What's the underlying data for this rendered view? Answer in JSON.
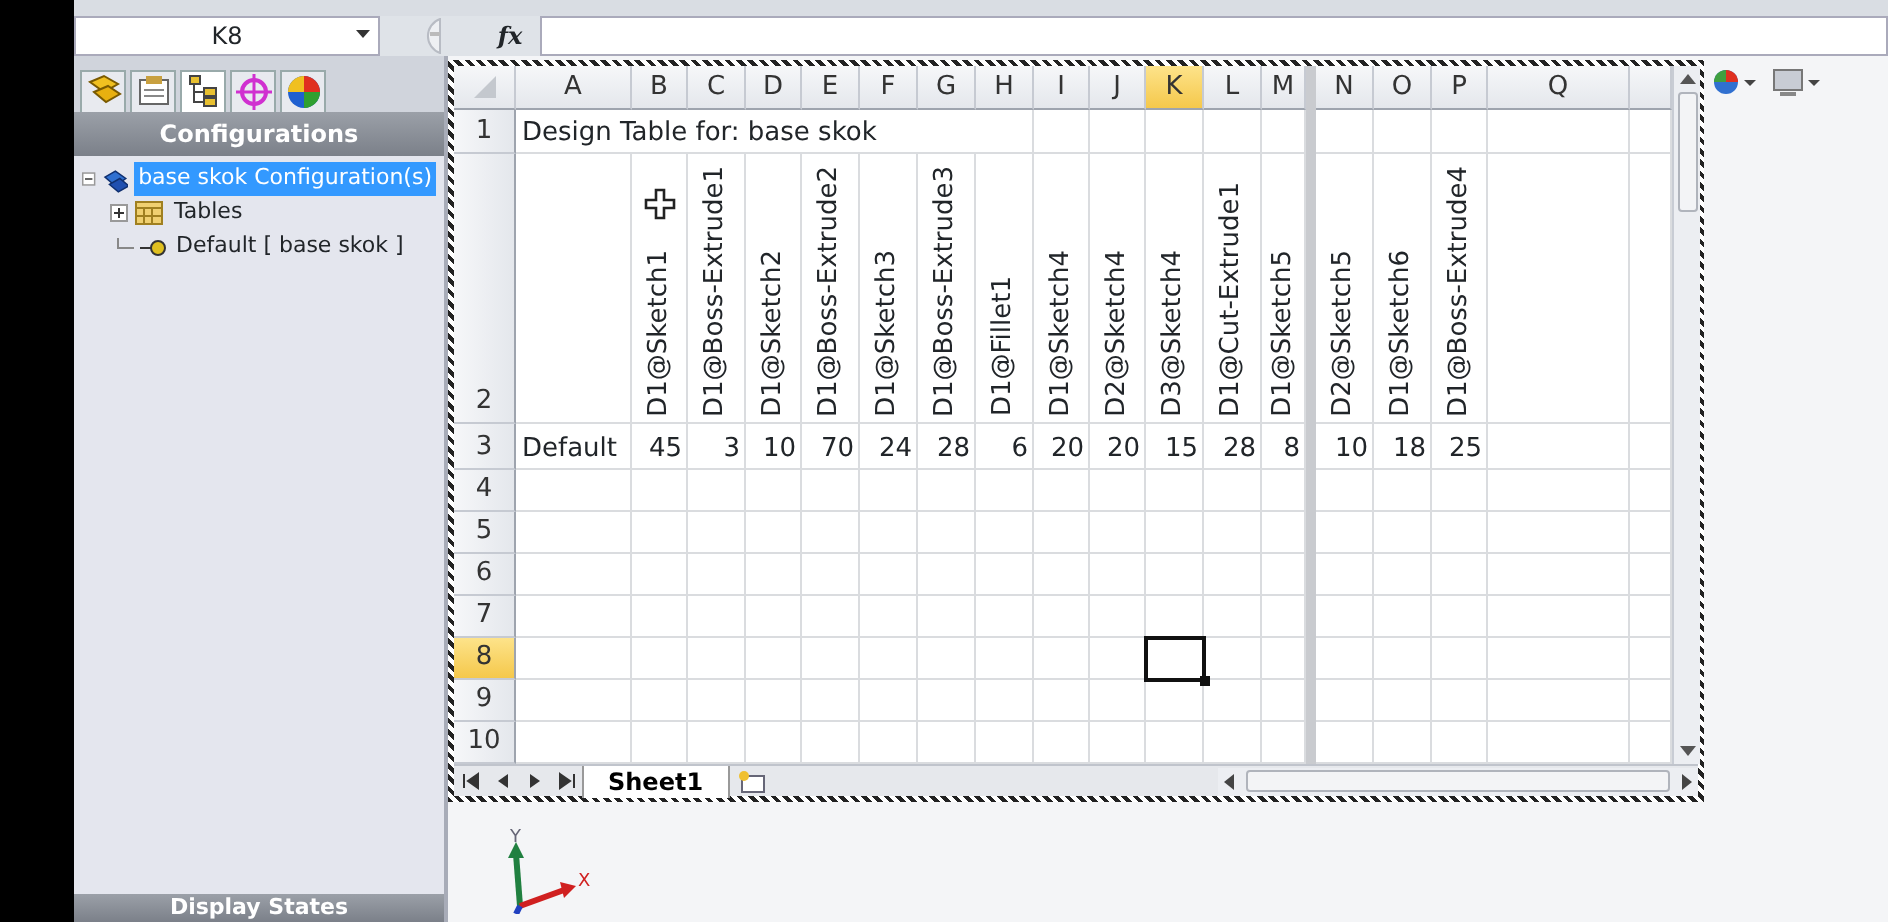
{
  "formula_bar": {
    "name_box": "K8",
    "function_label": "fx"
  },
  "config_panel": {
    "tabs": [
      {
        "selected": false
      },
      {
        "selected": false
      },
      {
        "selected": true
      },
      {
        "selected": false
      },
      {
        "selected": false
      }
    ],
    "title": "Configurations",
    "tree": [
      {
        "label": "base skok Configuration(s)",
        "selected": true,
        "expanded": true,
        "children": [
          {
            "label": "Tables",
            "selected": false,
            "expanded": false
          },
          {
            "label": "Default [ base skok ]",
            "selected": false
          }
        ]
      }
    ],
    "footer_title": "Display States"
  },
  "sheet": {
    "columns": [
      {
        "label": "A",
        "selected": false,
        "split_after": false
      },
      {
        "label": "B",
        "selected": false,
        "split_after": false
      },
      {
        "label": "C",
        "selected": false,
        "split_after": false
      },
      {
        "label": "D",
        "selected": false,
        "split_after": false
      },
      {
        "label": "E",
        "selected": false,
        "split_after": false
      },
      {
        "label": "F",
        "selected": false,
        "split_after": false
      },
      {
        "label": "G",
        "selected": false,
        "split_after": false
      },
      {
        "label": "H",
        "selected": false,
        "split_after": false
      },
      {
        "label": "I",
        "selected": false,
        "split_after": false
      },
      {
        "label": "J",
        "selected": false,
        "split_after": false
      },
      {
        "label": "K",
        "selected": true,
        "split_after": false
      },
      {
        "label": "L",
        "selected": false,
        "split_after": false
      },
      {
        "label": "M",
        "selected": false,
        "split_after": true
      },
      {
        "label": "N",
        "selected": false,
        "split_after": false
      },
      {
        "label": "O",
        "selected": false,
        "split_after": false
      },
      {
        "label": "P",
        "selected": false,
        "split_after": false
      },
      {
        "label": "Q",
        "selected": false,
        "split_after": false
      }
    ],
    "rows": [
      {
        "label": "1",
        "selected": false,
        "kind": "title",
        "text": "Design Table for: base skok"
      },
      {
        "label": "2",
        "selected": false,
        "kind": "headers",
        "cells": [
          "D1@Sketch1",
          "D1@Boss-Extrude1",
          "D1@Sketch2",
          "D1@Boss-Extrude2",
          "D1@Sketch3",
          "D1@Boss-Extrude3",
          "D1@Fillet1",
          "D1@Sketch4",
          "D2@Sketch4",
          "D3@Sketch4",
          "D1@Cut-Extrude1",
          "D1@Sketch5",
          "D2@Sketch5",
          "D1@Sketch6",
          "D1@Boss-Extrude4"
        ]
      },
      {
        "label": "3",
        "selected": false,
        "kind": "values",
        "name": "Default",
        "cells": [
          "45",
          "3",
          "10",
          "70",
          "24",
          "28",
          "6",
          "20",
          "20",
          "15",
          "28",
          "8",
          "10",
          "18",
          "25"
        ]
      },
      {
        "label": "4",
        "selected": false,
        "kind": "empty"
      },
      {
        "label": "5",
        "selected": false,
        "kind": "empty"
      },
      {
        "label": "6",
        "selected": false,
        "kind": "empty"
      },
      {
        "label": "7",
        "selected": false,
        "kind": "empty"
      },
      {
        "label": "8",
        "selected": true,
        "kind": "empty"
      },
      {
        "label": "9",
        "selected": false,
        "kind": "empty"
      },
      {
        "label": "10",
        "selected": false,
        "kind": "empty"
      }
    ],
    "sheet_tabs": [
      {
        "label": "Sheet1",
        "selected": true
      }
    ]
  },
  "triad": {
    "y_label": "Y",
    "x_label": "X"
  }
}
